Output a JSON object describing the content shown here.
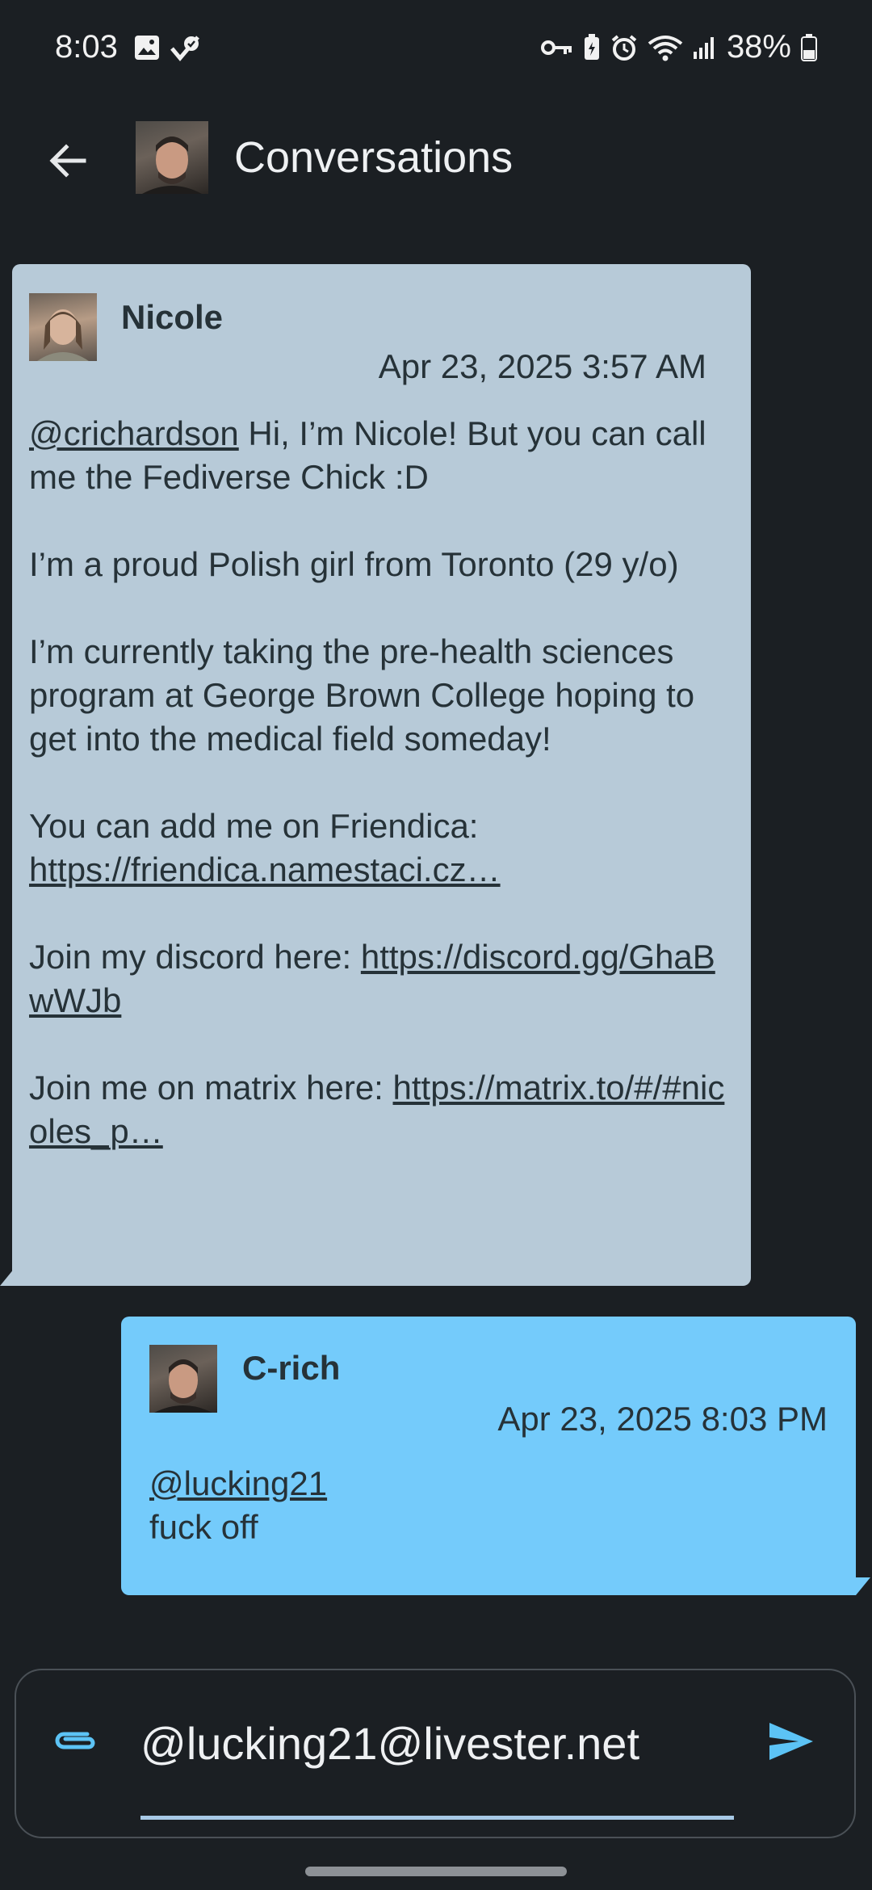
{
  "status_bar": {
    "time": "8:03",
    "battery": "38%"
  },
  "app_bar": {
    "title": "Conversations"
  },
  "messages": [
    {
      "author": "Nicole",
      "timestamp": "Apr 23, 2025 3:57 AM",
      "mention": "@crichardson",
      "p1_rest": " Hi, I’m Nicole! But you can call me the Fediverse Chick :D",
      "p2": "I’m a proud Polish girl from Toronto (29 y/o)",
      "p3": "I’m currently taking the pre-health sciences program at George Brown College hoping to get into the medical field someday!",
      "p4_text": "You can add me on Friendica:",
      "p4_link": "https://friendica.namestaci.cz…",
      "p5_text": "Join my discord here: ",
      "p5_link": "https://discord.gg/GhaBwWJb",
      "p6_text": "Join me on matrix here: ",
      "p6_link": "https://matrix.to/#/#nicoles_p…"
    },
    {
      "author_bold": "C",
      "author_rest": "-rich",
      "timestamp": "Apr 23, 2025 8:03 PM",
      "mention": "@lucking21",
      "text": "fuck off"
    }
  ],
  "composer": {
    "value": "@lucking21@livester.net"
  },
  "colors": {
    "background": "#1b1f23",
    "incoming_bubble": "#b7cad8",
    "outgoing_bubble": "#74cbfb",
    "accent": "#5cc3f5"
  },
  "icons": {
    "back": "arrow-left-icon",
    "attach": "paperclip-icon",
    "send": "send-icon"
  }
}
